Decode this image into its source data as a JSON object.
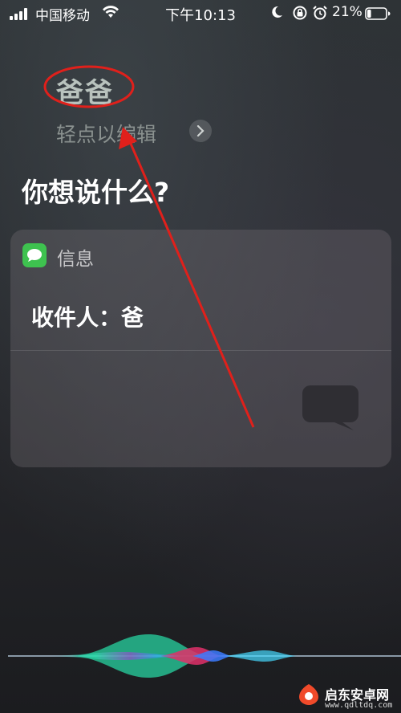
{
  "status_bar": {
    "carrier": "中国移动",
    "time": "下午10:13",
    "battery_percent": "21%",
    "battery_level": 0.21,
    "icons": [
      "signal-icon",
      "wifi-icon",
      "moon-icon",
      "rotation-lock-icon",
      "alarm-icon",
      "battery-icon"
    ]
  },
  "siri": {
    "heard_text": "爸爸",
    "tap_to_edit": "轻点以编辑",
    "prompt": "你想说什么?"
  },
  "message_card": {
    "app_name": "信息",
    "recipient": "收件人：爸",
    "app_icon_color": "#3ec24f"
  },
  "watermark": {
    "title": "启东安卓网",
    "url": "www.qdltdq.com"
  },
  "colors": {
    "annotation_red": "#e0201b"
  }
}
